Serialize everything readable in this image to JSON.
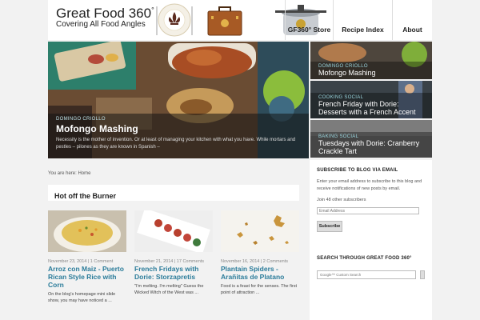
{
  "header": {
    "site_title": "Great Food 360",
    "site_title_sup": "°",
    "tagline": "Covering All Food Angles",
    "nav": [
      {
        "label": "GF360° Store"
      },
      {
        "label": "Recipe Index"
      },
      {
        "label": "About"
      }
    ]
  },
  "slider": {
    "hero": {
      "category": "DOMINGO CRIOLLO",
      "title": "Mofongo Mashing",
      "excerpt": "Necessity is the mother of invention. Or at least of managing your kitchen with what you have. While mortars and pestles – pilones as they are known in Spanish –"
    },
    "thumbs": [
      {
        "category": "DOMINGO CRIOLLO",
        "title": "Mofongo Mashing"
      },
      {
        "category": "COOKING SOCIAL",
        "title": "French Friday with Dorie: Desserts with a French Accent"
      },
      {
        "category": "BAKING SOCIAL",
        "title": "Tuesdays with Dorie: Cranberry Crackle Tart"
      }
    ]
  },
  "breadcrumb": "You are here: Home",
  "section": {
    "title": "Hot off the Burner"
  },
  "posts": [
    {
      "meta": "November 23, 2014 | 1 Comment",
      "title": "Arroz con Maiz - Puerto Rican Style Rice with Corn",
      "excerpt": "On the blog's homepage mini slide show, you may have noticed a ..."
    },
    {
      "meta": "November 21, 2014 | 17 Comments",
      "title": "French Fridays with Dorie: Storzapretis",
      "excerpt": "\"I'm melting.  I'm melting\" Guess the Wicked Witch of the West was ..."
    },
    {
      "meta": "November 16, 2014 | 2 Comments",
      "title": "Plantain Spiders - Arañitas de Platano",
      "excerpt": "Food is a feast for the senses.  The first point of attraction ..."
    }
  ],
  "sidebar": {
    "subscribe": {
      "title": "Subscribe to Blog via Email",
      "text": "Enter your email address to subscribe to this blog and receive notifications of new posts by email.",
      "subscribers": "Join 48 other subscribers",
      "email_placeholder": "Email Address",
      "button": "Subscribe"
    },
    "search": {
      "title": "Search Through Great Food 360°",
      "placeholder": "Google™ Custom Search"
    }
  },
  "colors": {
    "link": "#2b7c9a",
    "category": "#9ad6df",
    "background": "#f2f2f2"
  }
}
